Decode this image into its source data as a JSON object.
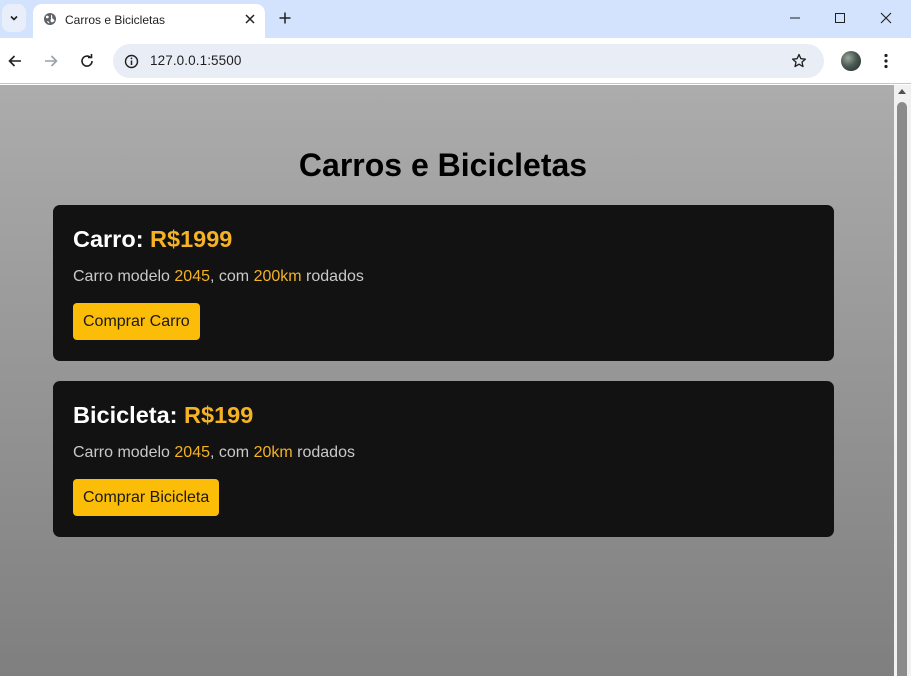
{
  "browser": {
    "tab_title": "Carros e Bicicletas",
    "url": "127.0.0.1:5500"
  },
  "page": {
    "title": "Carros e Bicicletas",
    "cards": [
      {
        "name": "Carro",
        "price": "R$1999",
        "desc_prefix": "Carro modelo",
        "model": "2045",
        "desc_mid": ", com",
        "mileage": "200km",
        "desc_suffix": "rodados",
        "button_label": "Comprar Carro"
      },
      {
        "name": "Bicicleta",
        "price": "R$199",
        "desc_prefix": "Carro modelo",
        "model": "2045",
        "desc_mid": ", com",
        "mileage": "20km",
        "desc_suffix": "rodados",
        "button_label": "Comprar Bicicleta"
      }
    ]
  },
  "colors": {
    "accent": "#f4b224",
    "button": "#fbbd08",
    "card_bg": "#121212"
  }
}
